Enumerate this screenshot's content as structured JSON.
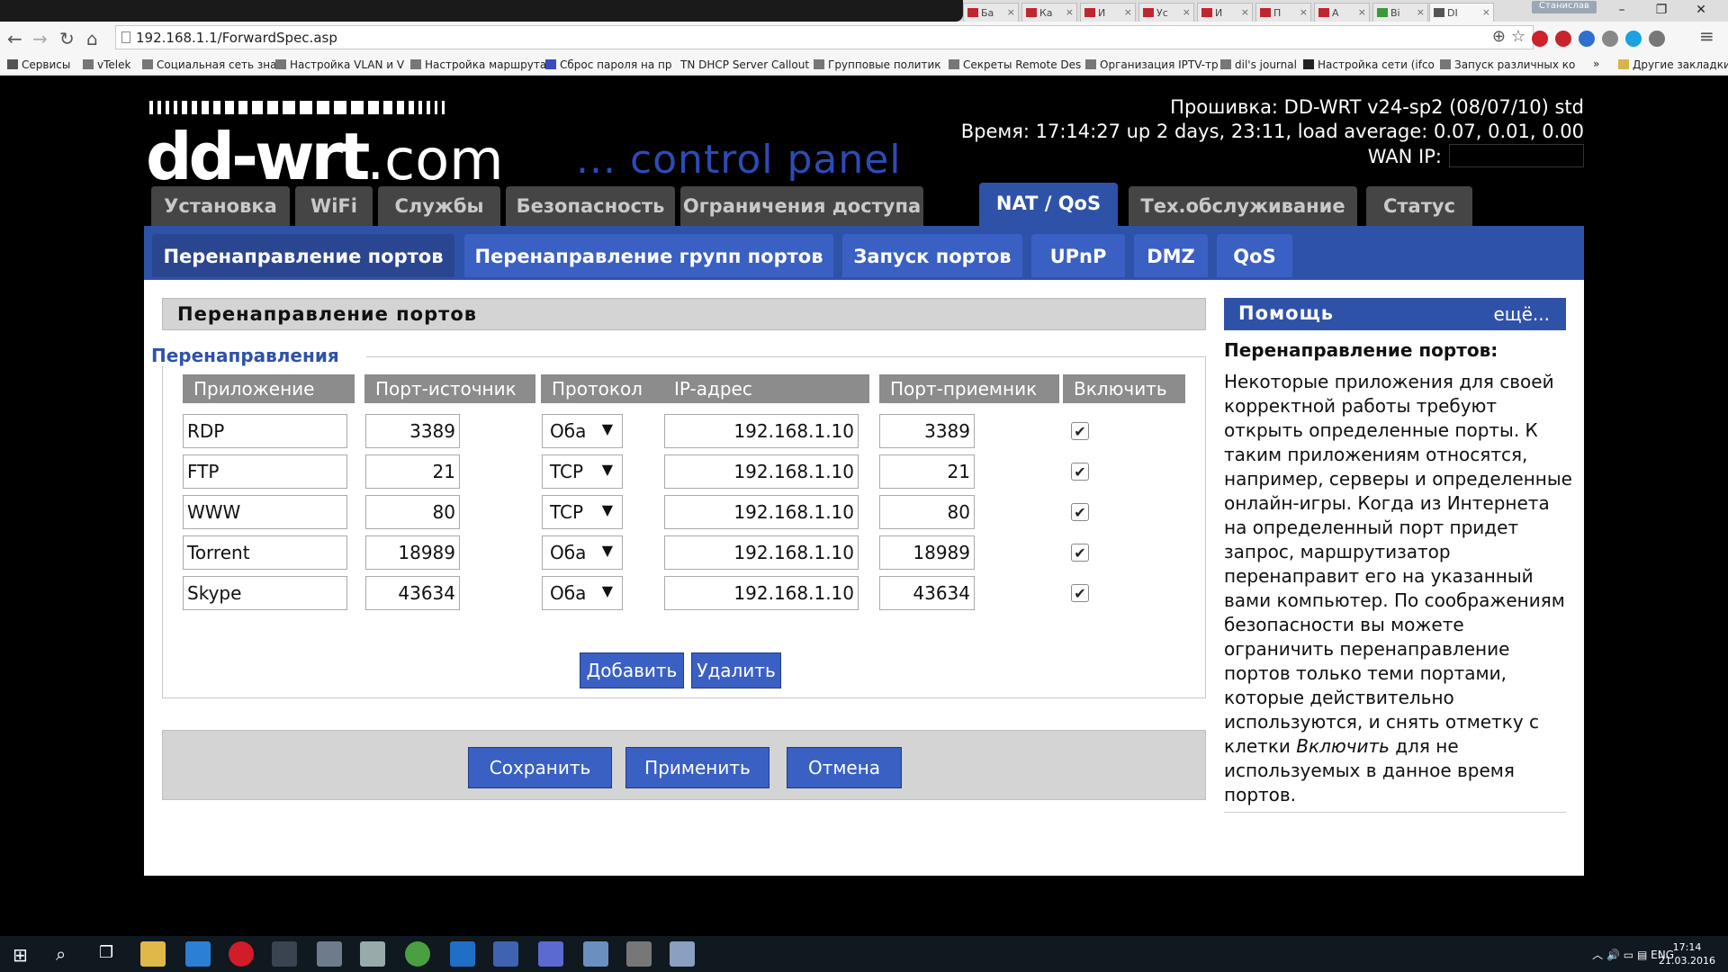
{
  "browser": {
    "tabs": [
      "Ба",
      "Ка",
      "И",
      "Ус",
      "И",
      "П",
      "А",
      "Ві",
      "DI"
    ],
    "profile": "Станислав",
    "url": "192.168.1.1/ForwardSpec.asp",
    "bookmarks": [
      "Сервисы",
      "vTelek",
      "Социальная сеть зна",
      "Настройка VLAN и V",
      "Настройка маршрута",
      "Сброс пароля на пр",
      "TN DHCP Server Callout",
      "Групповые политик",
      "Секреты Remote Des",
      "Организация IPTV-тр",
      "dil's journal",
      "Настройка сети (ifco",
      "Запуск различных ко"
    ],
    "other_bookmarks": "Другие закладки"
  },
  "header": {
    "logo_main": "dd-wrt",
    "logo_com": ".com",
    "control_panel": "... control panel",
    "firmware": "Прошивка: DD-WRT v24-sp2 (08/07/10) std",
    "time": "Время: 17:14:27 up 2 days, 23:11, load average: 0.07, 0.01, 0.00",
    "wan_label": "WAN IP:"
  },
  "main_tabs": [
    "Установка",
    "WiFi",
    "Службы",
    "Безопасность",
    "Ограничения доступа",
    "NAT / QoS",
    "Тех.обслуживание",
    "Статус"
  ],
  "sub_tabs": [
    "Перенаправление портов",
    "Перенаправление групп портов",
    "Запуск портов",
    "UPnP",
    "DMZ",
    "QoS"
  ],
  "section": {
    "title": "Перенаправление портов",
    "legend": "Перенаправления",
    "columns": [
      "Приложение",
      "Порт-источник",
      "Протокол",
      "IP-адрес",
      "Порт-приемник",
      "Включить"
    ],
    "rows": [
      {
        "app": "RDP",
        "src": "3389",
        "proto": "Оба",
        "ip": "192.168.1.10",
        "dst": "3389",
        "enabled": "✔"
      },
      {
        "app": "FTP",
        "src": "21",
        "proto": "TCP",
        "ip": "192.168.1.10",
        "dst": "21",
        "enabled": "✔"
      },
      {
        "app": "WWW",
        "src": "80",
        "proto": "TCP",
        "ip": "192.168.1.10",
        "dst": "80",
        "enabled": "✔"
      },
      {
        "app": "Torrent",
        "src": "18989",
        "proto": "Оба",
        "ip": "192.168.1.10",
        "dst": "18989",
        "enabled": "✔"
      },
      {
        "app": "Skype",
        "src": "43634",
        "proto": "Оба",
        "ip": "192.168.1.10",
        "dst": "43634",
        "enabled": "✔"
      }
    ],
    "add_label": "Добавить",
    "remove_label": "Удалить"
  },
  "footer_buttons": {
    "save": "Сохранить",
    "apply": "Применить",
    "cancel": "Отмена"
  },
  "help": {
    "header": "Помощь",
    "more": "ещё...",
    "title": "Перенаправление портов:",
    "text_1": "Некоторые приложения для своей корректной работы требуют открыть определенные порты. К таким приложениям относятся, например, серверы и определенные онлайн-игры. Когда из Интернета на определенный порт придет запрос, маршрутизатор перенаправит его на указанный вами компьютер. По соображениям безопасности вы можете ограничить перенаправление портов только теми портами, которые действительно используются, и снять отметку с клетки ",
    "text_em": "Включить",
    "text_2": " для не используемых в данное время портов."
  },
  "taskbar": {
    "lang": "ENG",
    "time": "17:14",
    "date": "21.03.2016"
  }
}
